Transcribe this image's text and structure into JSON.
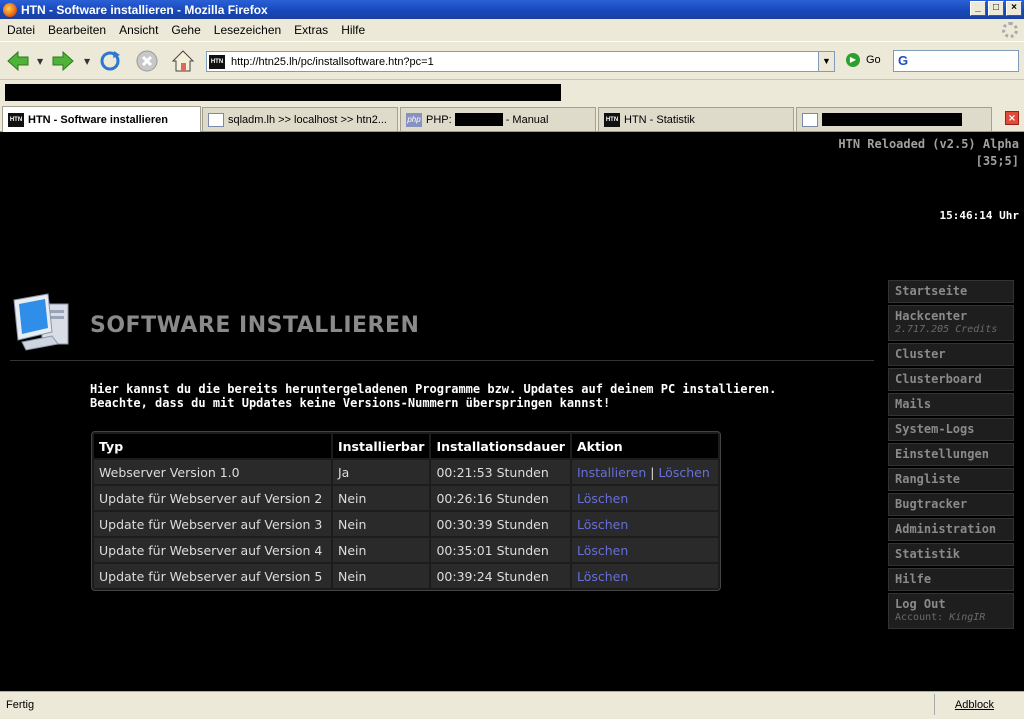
{
  "window": {
    "title": "HTN - Software installieren - Mozilla Firefox"
  },
  "menu": [
    "Datei",
    "Bearbeiten",
    "Ansicht",
    "Gehe",
    "Lesezeichen",
    "Extras",
    "Hilfe"
  ],
  "nav": {
    "url": "http://htn25.lh/pc/installsoftware.htn?pc=1",
    "go_label": "Go",
    "search_engine_icon": "G"
  },
  "tabs": [
    {
      "label": "HTN - Software installieren",
      "icon": "HTN"
    },
    {
      "label": "sqladm.lh >> localhost >> htn2...",
      "icon": "page"
    },
    {
      "label_prefix": "PHP:",
      "label_suffix": "- Manual",
      "icon": "php"
    },
    {
      "label": "HTN - Statistik",
      "icon": "HTN"
    },
    {
      "label": "",
      "icon": "page"
    }
  ],
  "page": {
    "version": "HTN Reloaded (v2.5) Alpha",
    "coords": "[35;5]",
    "clock": "15:46:14 Uhr",
    "heading": "SOFTWARE INSTALLIEREN",
    "intro_line1": "Hier kannst du die bereits heruntergeladenen Programme bzw. Updates auf deinem PC installieren.",
    "intro_line2": "Beachte, dass du mit Updates keine Versions-Nummern überspringen kannst!",
    "table": {
      "headers": [
        "Typ",
        "Installierbar",
        "Installationsdauer",
        "Aktion"
      ],
      "rows": [
        {
          "typ": "Webserver Version 1.0",
          "installierbar": "Ja",
          "dauer": "00:21:53 Stunden",
          "install": "Installieren",
          "sep": "|",
          "delete": "Löschen"
        },
        {
          "typ": "Update für Webserver auf Version 2",
          "installierbar": "Nein",
          "dauer": "00:26:16 Stunden",
          "delete": "Löschen"
        },
        {
          "typ": "Update für Webserver auf Version 3",
          "installierbar": "Nein",
          "dauer": "00:30:39 Stunden",
          "delete": "Löschen"
        },
        {
          "typ": "Update für Webserver auf Version 4",
          "installierbar": "Nein",
          "dauer": "00:35:01 Stunden",
          "delete": "Löschen"
        },
        {
          "typ": "Update für Webserver auf Version 5",
          "installierbar": "Nein",
          "dauer": "00:39:24 Stunden",
          "delete": "Löschen"
        }
      ]
    },
    "sidebar": {
      "startseite": "Startseite",
      "hackcenter": "Hackcenter",
      "credits": "2.717.205 Credits",
      "items": [
        "Cluster",
        "Clusterboard",
        "Mails",
        "System-Logs",
        "Einstellungen",
        "Rangliste",
        "Bugtracker",
        "Administration",
        "Statistik",
        "Hilfe"
      ],
      "logout": "Log Out",
      "account_label": "Account:",
      "account_name": "KingIR"
    }
  },
  "status": {
    "text": "Fertig",
    "adblock": "Adblock"
  },
  "colors": {
    "ja": "#2aa02a",
    "nein": "#e02020",
    "link": "#6670d8"
  }
}
